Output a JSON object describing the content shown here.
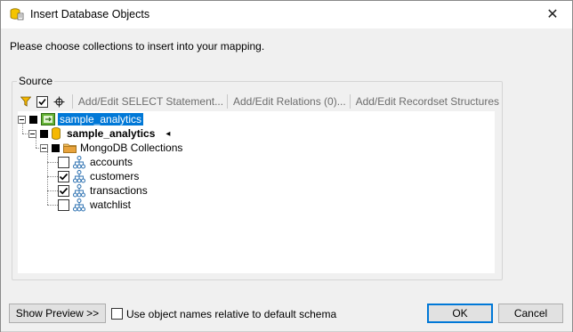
{
  "window": {
    "title": "Insert Database Objects",
    "close_glyph": "✕"
  },
  "instruction": "Please choose collections to insert into your mapping.",
  "source": {
    "label": "Source",
    "toolbar": {
      "filter_icon": "filter-icon",
      "check_icon": "check-all-icon",
      "locate_icon": "locate-icon",
      "add_edit_select": "Add/Edit SELECT Statement...",
      "add_edit_relations": "Add/Edit Relations (0)...",
      "add_edit_recordset": "Add/Edit Recordset Structures"
    },
    "tree": {
      "root": {
        "label": "sample_analytics"
      },
      "database": {
        "label": "sample_analytics",
        "marker": "◂"
      },
      "folder": {
        "label": "MongoDB Collections"
      },
      "collections": [
        {
          "label": "accounts",
          "checked": false
        },
        {
          "label": "customers",
          "checked": true
        },
        {
          "label": "transactions",
          "checked": true
        },
        {
          "label": "watchlist",
          "checked": false
        }
      ]
    }
  },
  "footer": {
    "show_preview": "Show Preview >>",
    "use_relative_names": "Use object names relative to default schema",
    "ok": "OK",
    "cancel": "Cancel"
  },
  "colors": {
    "selection": "#0078d7",
    "filter_icon": "#f2b500",
    "db_icon": "#f5b800",
    "folder": "#e8a33c"
  }
}
